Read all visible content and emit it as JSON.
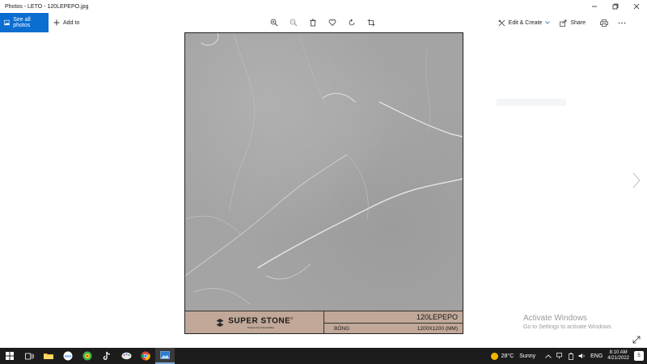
{
  "window": {
    "title": "Photos - LETO - 120LEPEPO.jpg"
  },
  "toolbar": {
    "see_all_label": "See all photos",
    "add_to_label": "Add to",
    "edit_create_label": "Edit & Create",
    "share_label": "Share",
    "icons": [
      "zoom-in-icon",
      "zoom-out-icon",
      "delete-icon",
      "heart-icon",
      "rotate-icon",
      "crop-icon"
    ]
  },
  "photo": {
    "brand_name": "SUPER STONE",
    "brand_registered": "®",
    "brand_tagline": "Powered by Kamandtiles",
    "product_code": "120LEPEPO",
    "finish": "BÓNG",
    "size": "1200X1200 (MM)",
    "band_color": "#c1a898"
  },
  "activation": {
    "line1": "Activate Windows",
    "line2": "Go to Settings to activate Windows."
  },
  "taskbar": {
    "temperature": "28°C",
    "weather": "Sunny",
    "language": "ENG",
    "time": "8:10 AM",
    "date": "4/21/2022",
    "notifications": "5"
  },
  "colors": {
    "accent": "#0a6ed1",
    "taskbar": "#1c1c1c"
  }
}
